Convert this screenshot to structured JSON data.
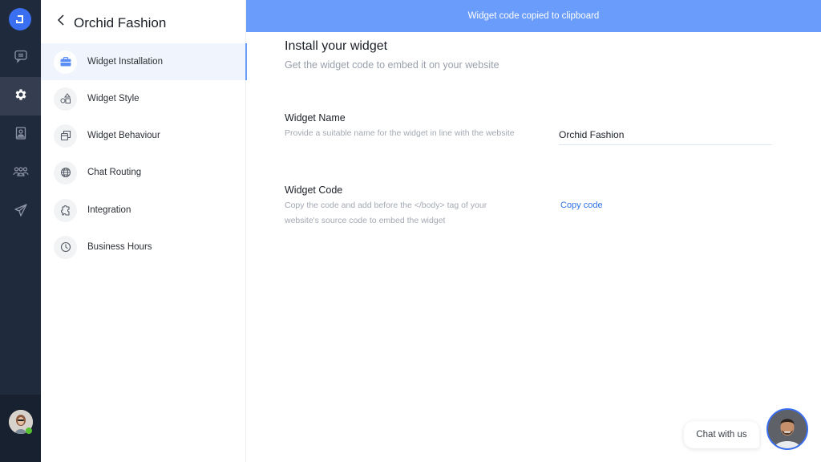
{
  "rail": {
    "logo_icon": "app-logo-icon",
    "items": [
      {
        "name": "conversations",
        "icon": "chat-icon",
        "active": false
      },
      {
        "name": "settings",
        "icon": "gear-icon",
        "active": true
      },
      {
        "name": "contacts",
        "icon": "contact-book-icon",
        "active": false
      },
      {
        "name": "team",
        "icon": "team-icon",
        "active": false
      },
      {
        "name": "campaigns",
        "icon": "send-icon",
        "active": false
      }
    ],
    "user_status": "online",
    "status_color": "#56c232"
  },
  "sidebar": {
    "title": "Orchid Fashion",
    "items": [
      {
        "label": "Widget Installation",
        "icon": "briefcase-icon",
        "active": true
      },
      {
        "label": "Widget Style",
        "icon": "shapes-icon",
        "active": false
      },
      {
        "label": "Widget Behaviour",
        "icon": "window-stack-icon",
        "active": false
      },
      {
        "label": "Chat Routing",
        "icon": "globe-icon",
        "active": false
      },
      {
        "label": "Integration",
        "icon": "puzzle-icon",
        "active": false
      },
      {
        "label": "Business Hours",
        "icon": "clock-icon",
        "active": false
      }
    ]
  },
  "toast": {
    "message": "Widget code copied to clipboard",
    "color": "#6a9cfb"
  },
  "main": {
    "title": "Install your widget",
    "subtitle": "Get the widget code to embed it on your website",
    "widget_name": {
      "label": "Widget Name",
      "description": "Provide a suitable name for the widget in line with the website",
      "value": "Orchid Fashion"
    },
    "widget_code": {
      "label": "Widget Code",
      "description": "Copy the code and add before the </body> tag of your website's source code to embed the widget",
      "action": "Copy code"
    }
  },
  "chat_launcher": {
    "label": "Chat with us",
    "accent": "#3b6ff2"
  }
}
